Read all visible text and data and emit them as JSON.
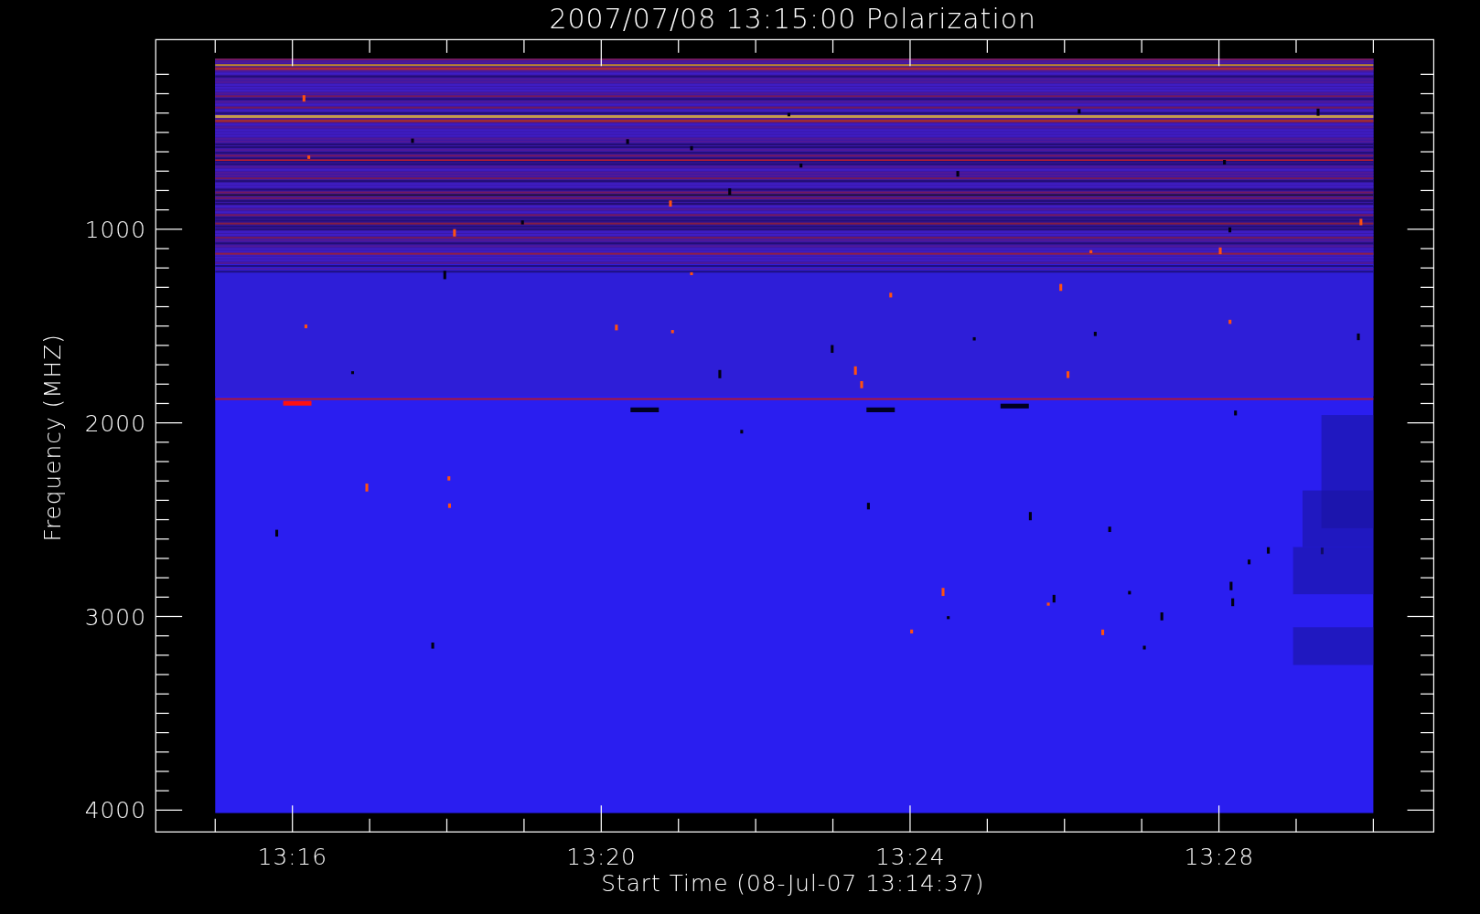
{
  "title": "2007/07/08 13:15:00 Polarization",
  "plot": {
    "ylabel": "Frequency (MHZ)",
    "xlabel": "Start Time (08-Jul-07 13:14:37)",
    "y_tick_labels": [
      "1000",
      "2000",
      "3000",
      "4000"
    ],
    "x_tick_labels": [
      "13:16",
      "13:20",
      "13:24",
      "13:28"
    ]
  }
}
